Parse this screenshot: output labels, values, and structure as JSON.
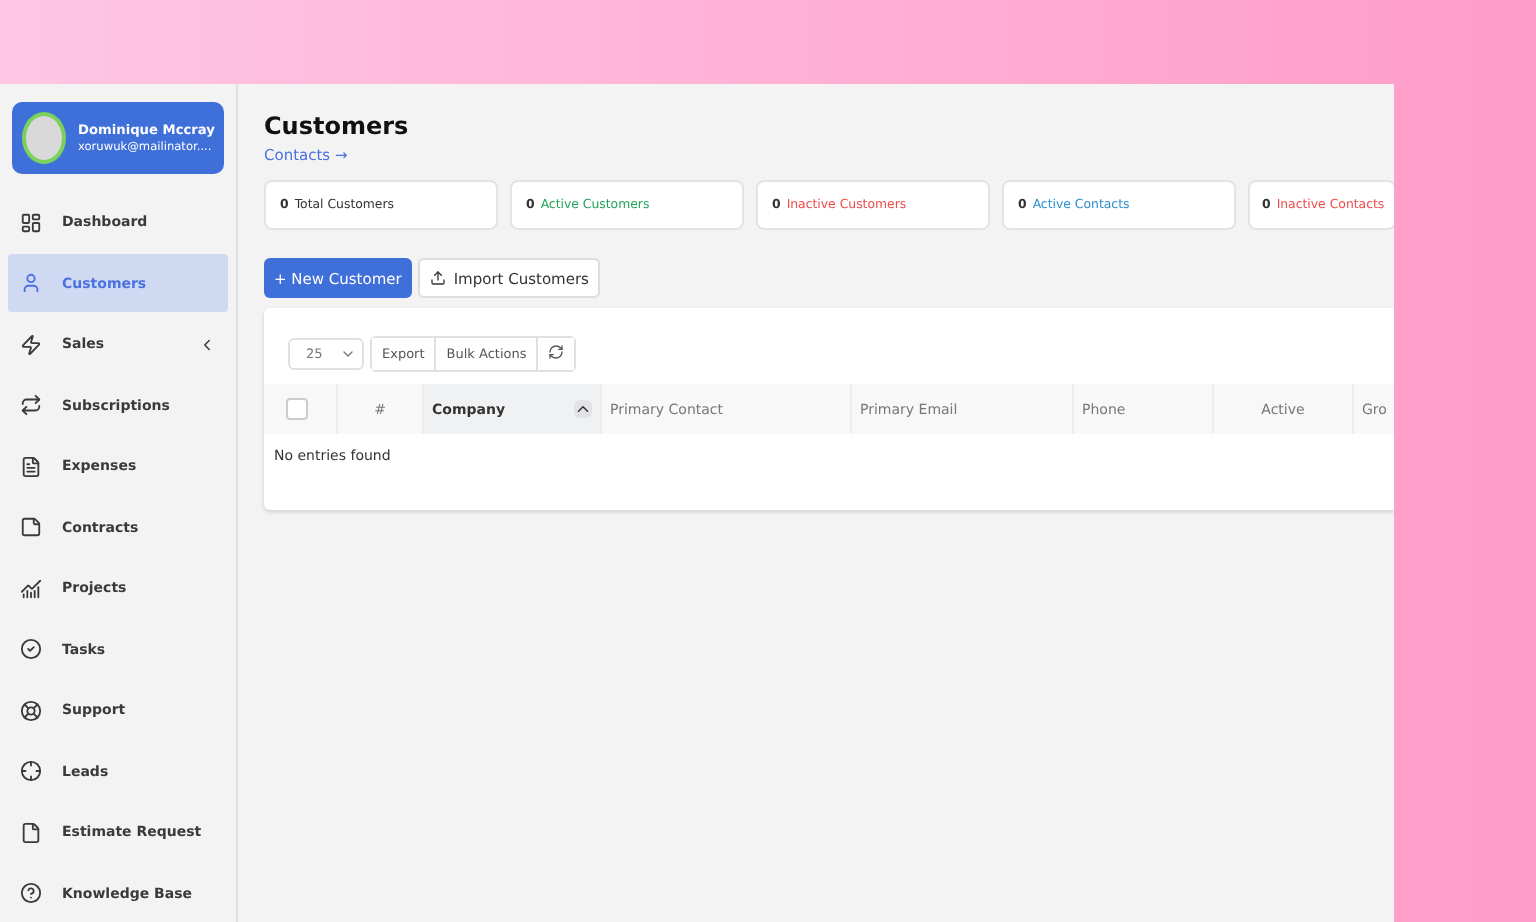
{
  "user": {
    "name": "Dominique Mccray",
    "email": "xoruwuk@mailinator...."
  },
  "sidebar": {
    "items": [
      {
        "label": "Dashboard",
        "selected": false
      },
      {
        "label": "Customers",
        "selected": true
      },
      {
        "label": "Sales",
        "selected": false,
        "expandable": true
      },
      {
        "label": "Subscriptions",
        "selected": false
      },
      {
        "label": "Expenses",
        "selected": false
      },
      {
        "label": "Contracts",
        "selected": false
      },
      {
        "label": "Projects",
        "selected": false
      },
      {
        "label": "Tasks",
        "selected": false
      },
      {
        "label": "Support",
        "selected": false
      },
      {
        "label": "Leads",
        "selected": false
      },
      {
        "label": "Estimate Request",
        "selected": false
      },
      {
        "label": "Knowledge Base",
        "selected": false
      }
    ]
  },
  "page": {
    "title": "Customers",
    "link": "Contacts →"
  },
  "stats": [
    {
      "count": "0",
      "label": "Total Customers",
      "color": "#333333"
    },
    {
      "count": "0",
      "label": "Active Customers",
      "color": "#22a55b"
    },
    {
      "count": "0",
      "label": "Inactive Customers",
      "color": "#ef4a4a"
    },
    {
      "count": "0",
      "label": "Active Contacts",
      "color": "#2b8fd0"
    },
    {
      "count": "0",
      "label": "Inactive Contacts",
      "color": "#ef4a4a"
    }
  ],
  "actions": {
    "primary": "+ New Customer",
    "secondary": "Import Customers"
  },
  "table": {
    "page_size": "25",
    "all_checked": false,
    "tools": [
      "Export",
      "Bulk Actions"
    ],
    "columns": [
      {
        "label": "#",
        "sorted": false
      },
      {
        "label": "Company",
        "sorted": true
      },
      {
        "label": "Primary Contact",
        "sorted": false
      },
      {
        "label": "Primary Email",
        "sorted": false
      },
      {
        "label": "Phone",
        "sorted": false
      },
      {
        "label": "Active",
        "sorted": false
      },
      {
        "label": "Gro",
        "sorted": false
      }
    ],
    "empty": "No entries found"
  }
}
